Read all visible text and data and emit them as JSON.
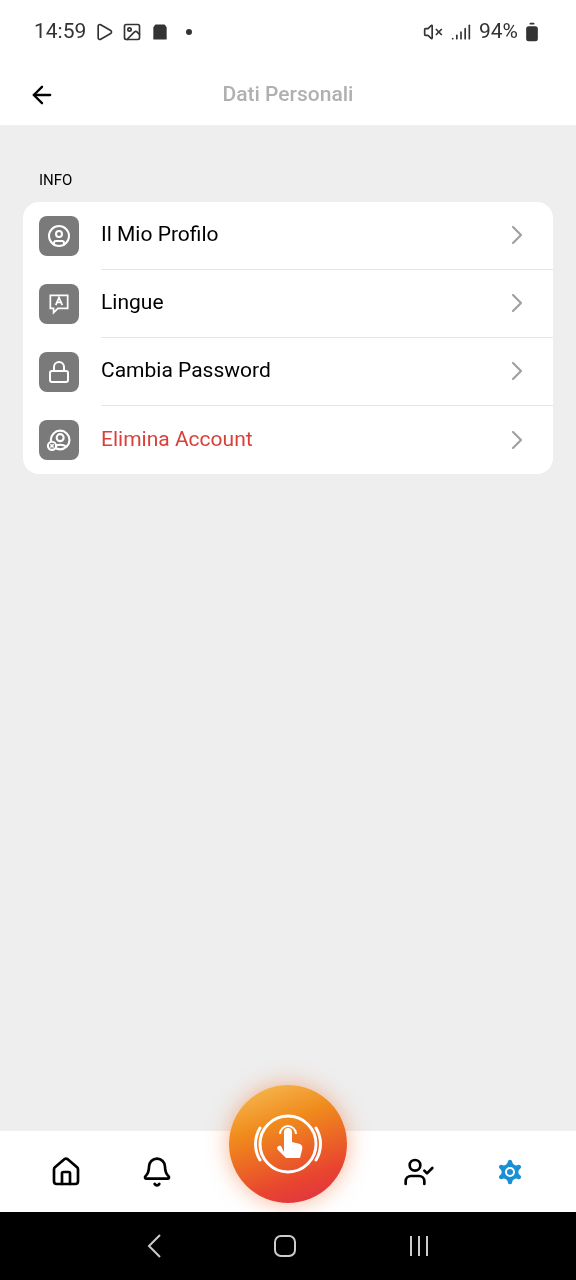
{
  "status_bar": {
    "time": "14:59",
    "battery": "94%"
  },
  "header": {
    "title": "Dati Personali"
  },
  "section": {
    "title": "INFO"
  },
  "items": [
    {
      "label": "Il Mio Profilo",
      "kind": "profile",
      "destructive": false
    },
    {
      "label": "Lingue",
      "kind": "language",
      "destructive": false
    },
    {
      "label": "Cambia Password",
      "kind": "lock",
      "destructive": false
    },
    {
      "label": "Elimina Account",
      "kind": "delete",
      "destructive": true
    }
  ],
  "nav": [
    {
      "kind": "home",
      "selected": false
    },
    {
      "kind": "bell",
      "selected": false
    },
    {
      "kind": "sos",
      "selected": false
    },
    {
      "kind": "user-shield",
      "selected": false
    },
    {
      "kind": "gear",
      "selected": true
    }
  ]
}
